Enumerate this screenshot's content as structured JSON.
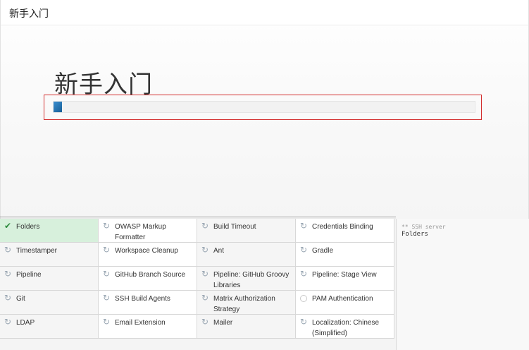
{
  "header": {
    "title": "新手入门"
  },
  "main": {
    "heading": "新手入门",
    "progress_fraction": 0.02
  },
  "plugins": [
    [
      {
        "label": "Folders",
        "status": "done",
        "icon": "checkmark-icon"
      },
      {
        "label": "OWASP Markup Formatter",
        "status": "pending",
        "icon": "refresh-icon"
      },
      {
        "label": "Build Timeout",
        "status": "pending",
        "icon": "refresh-icon"
      },
      {
        "label": "Credentials Binding",
        "status": "pending",
        "icon": "refresh-icon"
      }
    ],
    [
      {
        "label": "Timestamper",
        "status": "pending",
        "icon": "refresh-icon"
      },
      {
        "label": "Workspace Cleanup",
        "status": "pending",
        "icon": "refresh-icon"
      },
      {
        "label": "Ant",
        "status": "pending",
        "icon": "refresh-icon"
      },
      {
        "label": "Gradle",
        "status": "pending",
        "icon": "refresh-icon"
      }
    ],
    [
      {
        "label": "Pipeline",
        "status": "pending",
        "icon": "refresh-icon"
      },
      {
        "label": "GitHub Branch Source",
        "status": "pending",
        "icon": "refresh-icon"
      },
      {
        "label": "Pipeline: GitHub Groovy Libraries",
        "status": "pending",
        "icon": "refresh-icon"
      },
      {
        "label": "Pipeline: Stage View",
        "status": "pending",
        "icon": "refresh-icon"
      }
    ],
    [
      {
        "label": "Git",
        "status": "pending",
        "icon": "refresh-icon"
      },
      {
        "label": "SSH Build Agents",
        "status": "pending",
        "icon": "refresh-icon"
      },
      {
        "label": "Matrix Authorization Strategy",
        "status": "pending",
        "icon": "refresh-icon"
      },
      {
        "label": "PAM Authentication",
        "status": "not-started",
        "icon": "circle-icon"
      }
    ],
    [
      {
        "label": "LDAP",
        "status": "pending",
        "icon": "refresh-icon"
      },
      {
        "label": "Email Extension",
        "status": "pending",
        "icon": "refresh-icon"
      },
      {
        "label": "Mailer",
        "status": "pending",
        "icon": "refresh-icon"
      },
      {
        "label": "Localization: Chinese (Simplified)",
        "status": "pending",
        "icon": "refresh-icon"
      }
    ]
  ],
  "log": {
    "line1": "** SSH server",
    "line2": "Folders"
  },
  "colors": {
    "progress": "#2b77b6",
    "done_bg": "#d7f0dc",
    "highlight": "#d32f2f"
  }
}
